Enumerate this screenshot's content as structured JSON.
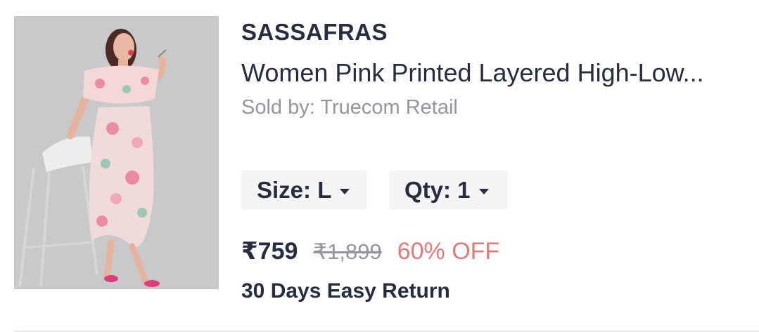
{
  "product": {
    "brand": "SASSAFRAS",
    "title": "Women Pink Printed Layered High-Low...",
    "seller": "Sold by: Truecom Retail",
    "size_label": "Size: L",
    "qty_label": "Qty: 1",
    "price": "₹759",
    "mrp": "₹1,899",
    "discount": "60% OFF",
    "return_policy": "30 Days Easy Return"
  },
  "colors": {
    "discount": "#e07b7b",
    "muted_text": "#94969f",
    "primary_text": "#282c3f",
    "selector_bg": "#f5f5f6"
  },
  "icons": {
    "size_dropdown": "chevron-down-icon",
    "qty_dropdown": "chevron-down-icon"
  }
}
